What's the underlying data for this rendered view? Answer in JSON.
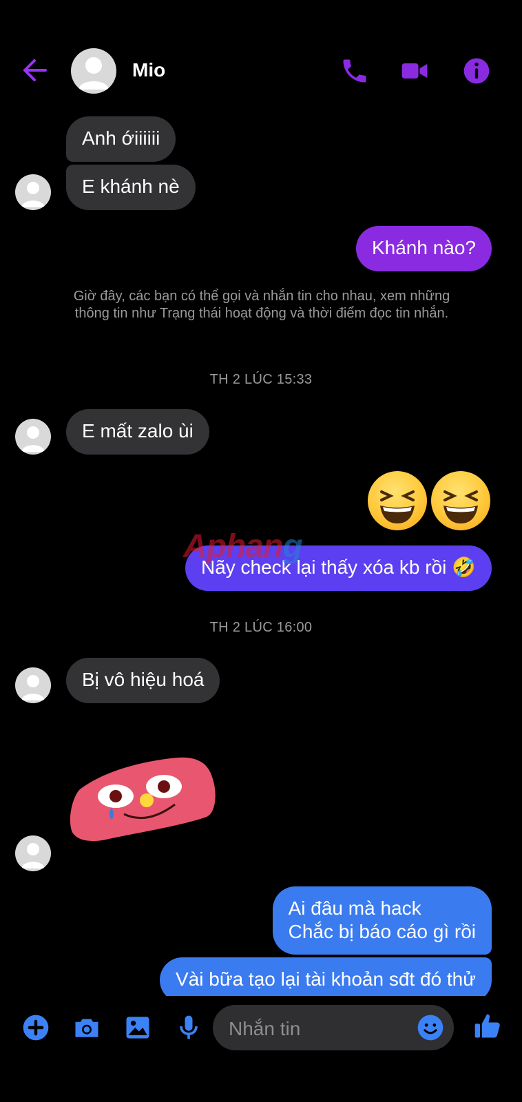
{
  "header": {
    "contact_name": "Mio",
    "icons": [
      "back-arrow-icon",
      "phone-icon",
      "video-camera-icon",
      "info-icon"
    ],
    "accent_color": "#8a2be2"
  },
  "messages": {
    "m1": "Anh ớiiiiii",
    "m2": "E khánh nè",
    "m3": "Khánh nào?",
    "system_notice": "Giờ đây, các bạn có thể gọi và nhắn tin cho nhau, xem những thông tin như Trạng thái hoạt động và thời điểm đọc tin nhắn.",
    "time1": "TH 2 LÚC 15:33",
    "m4": "E mất zalo ùi",
    "m5_emoji": "😆😆",
    "m6": "Nãy check lại thấy xóa kb rồi 🤣",
    "time2": "TH 2 LÚC 16:00",
    "m7": "Bị vô hiệu hoá",
    "m9_line1": "Ai đâu mà hack",
    "m9_line2": "Chắc bị báo cáo gì rồi",
    "m10": "Vài bữa tạo lại tài khoản sđt đó thử"
  },
  "watermark": {
    "part1": "Aphan",
    "part2": "g"
  },
  "composer": {
    "placeholder": "Nhắn tin",
    "icons": [
      "plus-icon",
      "camera-icon",
      "image-icon",
      "microphone-icon",
      "emoji-icon",
      "thumbs-up-icon"
    ]
  },
  "colors": {
    "incoming": "#333336",
    "outgoing_purple": "#8a2be2",
    "outgoing_indigo": "#5b3ff0",
    "outgoing_blue": "#3b7bf0",
    "toolbar_blue": "#3b82f6"
  }
}
